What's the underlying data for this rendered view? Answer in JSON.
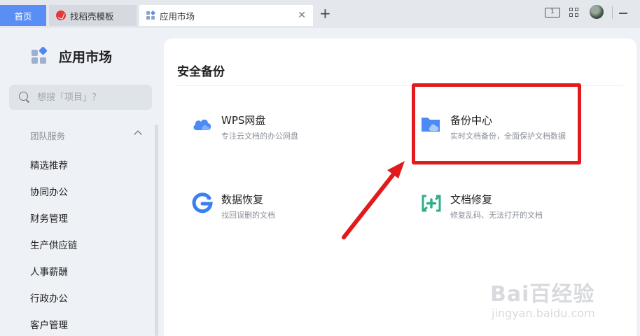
{
  "tabs": [
    {
      "label": "首页"
    },
    {
      "label": "找稻壳模板"
    },
    {
      "label": "应用市场"
    }
  ],
  "window": {
    "reader_badge": "1"
  },
  "sidebar": {
    "title": "应用市场",
    "search_placeholder": "想搜「项目」？",
    "group_label": "团队服务",
    "items": [
      {
        "label": "精选推荐"
      },
      {
        "label": "协同办公"
      },
      {
        "label": "财务管理"
      },
      {
        "label": "生产供应链"
      },
      {
        "label": "人事薪酬"
      },
      {
        "label": "行政办公"
      },
      {
        "label": "客户管理"
      }
    ]
  },
  "main": {
    "section_title": "安全备份",
    "apps": [
      {
        "title": "WPS网盘",
        "desc": "专注云文档的办公网盘",
        "icon": "cloud-icon"
      },
      {
        "title": "备份中心",
        "desc": "实时文档备份，全面保护文档数据",
        "icon": "folder-cloud-icon"
      },
      {
        "title": "数据恢复",
        "desc": "找回误删的文档",
        "icon": "restore-g-icon"
      },
      {
        "title": "文档修复",
        "desc": "修复乱码、无法打开的文档",
        "icon": "repair-icon"
      }
    ]
  },
  "colors": {
    "accent": "#5b8ef5",
    "annotation_red": "#e11b1b",
    "repair_green": "#2fae8b"
  },
  "watermark": {
    "main": "Bai百经验",
    "sub": "jingyan.baidu.com"
  }
}
